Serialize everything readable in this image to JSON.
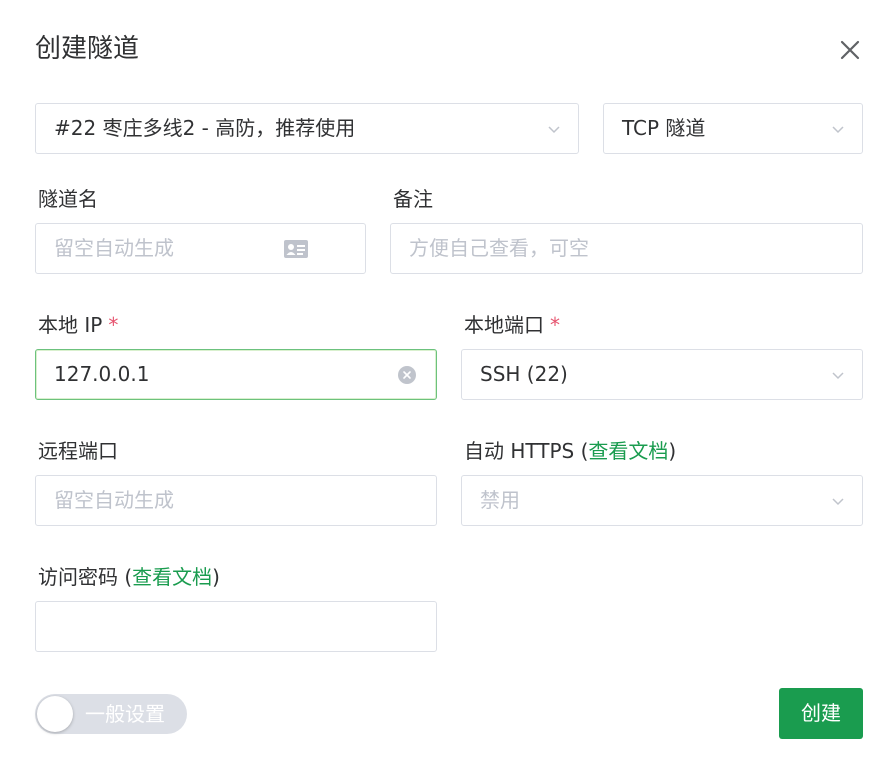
{
  "dialog": {
    "title": "创建隧道",
    "close_icon": "close-icon"
  },
  "node_select": {
    "value": "#22 枣庄多线2 - 高防，推荐使用"
  },
  "type_select": {
    "value": "TCP 隧道"
  },
  "tunnel_name": {
    "label": "隧道名",
    "placeholder": "留空自动生成"
  },
  "remark": {
    "label": "备注",
    "placeholder": "方便自己查看，可空"
  },
  "local_ip": {
    "label": "本地 IP",
    "required_mark": "*",
    "value": "127.0.0.1"
  },
  "local_port": {
    "label": "本地端口",
    "required_mark": "*",
    "value": "SSH (22)"
  },
  "remote_port": {
    "label": "远程端口",
    "placeholder": "留空自动生成"
  },
  "auto_https": {
    "label_prefix": "自动 HTTPS (",
    "link": "查看文档",
    "label_suffix": ")",
    "value": "禁用"
  },
  "access_password": {
    "label_prefix": "访问密码 (",
    "link": "查看文档",
    "label_suffix": ")",
    "value": ""
  },
  "general_settings_toggle": {
    "label": "一般设置",
    "on": false
  },
  "create_button": {
    "label": "创建"
  },
  "colors": {
    "accent": "#1a9c4f",
    "required": "#e6546f",
    "focus_border": "#6cc27d"
  }
}
